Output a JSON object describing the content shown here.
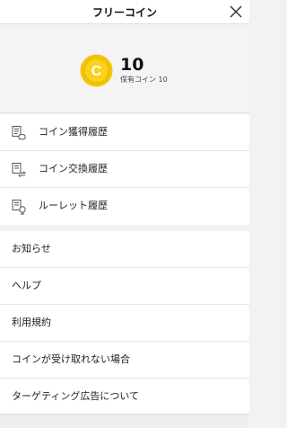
{
  "header": {
    "title": "フリーコイン",
    "close_icon": "close-icon"
  },
  "coin": {
    "icon_letter": "C",
    "count": "10",
    "owned_label": "保有コイン 10",
    "coin_color": "#f5c400"
  },
  "history": [
    {
      "label": "コイン獲得履歴",
      "icon": "coin-earn-history-icon"
    },
    {
      "label": "コイン交換履歴",
      "icon": "coin-exchange-history-icon"
    },
    {
      "label": "ルーレット履歴",
      "icon": "roulette-history-icon"
    }
  ],
  "info": [
    {
      "label": "お知らせ"
    },
    {
      "label": "ヘルプ"
    },
    {
      "label": "利用規約"
    },
    {
      "label": "コインが受け取れない場合"
    },
    {
      "label": "ターゲティング広告について"
    }
  ]
}
